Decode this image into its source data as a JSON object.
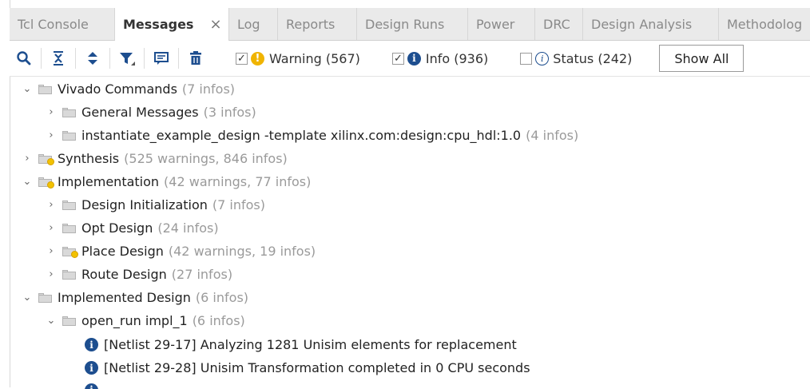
{
  "tabs": [
    {
      "label": "Tcl Console"
    },
    {
      "label": "Messages",
      "close": "×"
    },
    {
      "label": "Log"
    },
    {
      "label": "Reports"
    },
    {
      "label": "Design Runs"
    },
    {
      "label": "Power"
    },
    {
      "label": "DRC"
    },
    {
      "label": "Design Analysis"
    },
    {
      "label": "Methodolog"
    }
  ],
  "toolbar": {
    "filters": {
      "warning": {
        "label": "Warning (567)",
        "checked": true,
        "mark": "✓"
      },
      "info": {
        "label": "Info (936)",
        "checked": true,
        "mark": "✓"
      },
      "status": {
        "label": "Status (242)",
        "checked": false,
        "mark": ""
      }
    },
    "show_all_label": "Show All"
  },
  "tree": {
    "vivado_commands": {
      "label": "Vivado Commands",
      "meta": "(7 infos)"
    },
    "general_messages": {
      "label": "General Messages",
      "meta": "(3 infos)"
    },
    "instantiate": {
      "label": "instantiate_example_design -template xilinx.com:design:cpu_hdl:1.0",
      "meta": "(4 infos)"
    },
    "synthesis": {
      "label": "Synthesis",
      "meta": "(525 warnings, 846 infos)"
    },
    "implementation": {
      "label": "Implementation",
      "meta": "(42 warnings, 77 infos)"
    },
    "design_init": {
      "label": "Design Initialization",
      "meta": "(7 infos)"
    },
    "opt_design": {
      "label": "Opt Design",
      "meta": "(24 infos)"
    },
    "place_design": {
      "label": "Place Design",
      "meta": "(42 warnings, 19 infos)"
    },
    "route_design": {
      "label": "Route Design",
      "meta": "(27 infos)"
    },
    "implemented_design": {
      "label": "Implemented Design",
      "meta": "(6 infos)"
    },
    "open_run": {
      "label": "open_run impl_1",
      "meta": "(6 infos)"
    },
    "msg1": {
      "label": "[Netlist 29-17] Analyzing 1281 Unisim elements for replacement"
    },
    "msg2": {
      "label": "[Netlist 29-28] Unisim Transformation completed in 0 CPU seconds"
    }
  },
  "colors": {
    "warning": "#f0b400",
    "info": "#1d4e8f",
    "tab_bg": "#eaeaea"
  }
}
